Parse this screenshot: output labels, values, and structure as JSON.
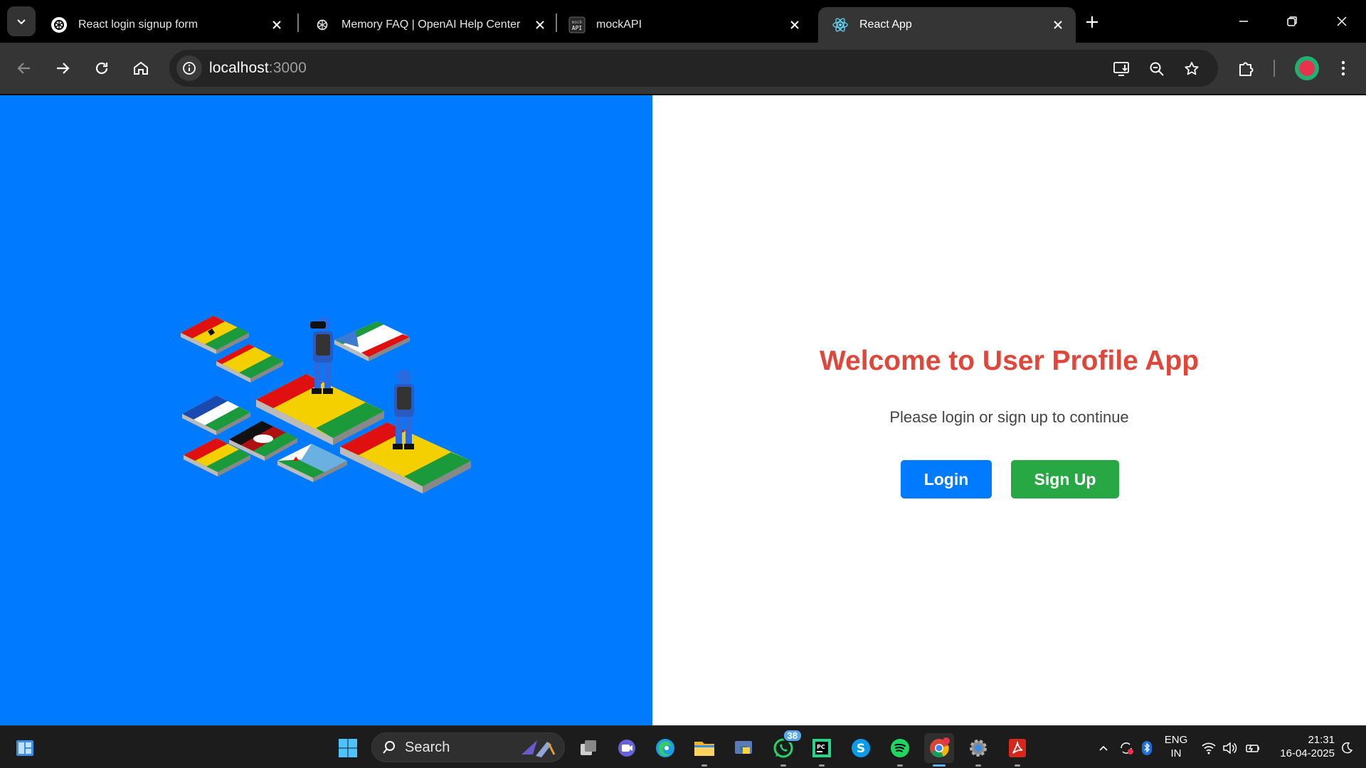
{
  "browser": {
    "tabs": [
      {
        "title": "React login signup form",
        "favicon": "openai-icon",
        "active": false
      },
      {
        "title": "Memory FAQ | OpenAI Help Center",
        "favicon": "openai-icon",
        "active": false
      },
      {
        "title": "mockAPI",
        "favicon": "mockapi-icon",
        "active": false
      },
      {
        "title": "React App",
        "favicon": "react-icon",
        "active": true
      }
    ],
    "url_host": "localhost",
    "url_port": ":3000"
  },
  "app": {
    "welcome_title": "Welcome to User Profile App",
    "subtitle": "Please login or sign up to continue",
    "login_label": "Login",
    "signup_label": "Sign Up",
    "colors": {
      "left_panel": "#007bff",
      "title": "#e0473a",
      "login_button": "#007bff",
      "signup_button": "#28a745"
    }
  },
  "taskbar": {
    "search_label": "Search",
    "whatsapp_badge": "38",
    "language": "ENG",
    "region": "IN",
    "time": "21:31",
    "date": "16-04-2025"
  }
}
